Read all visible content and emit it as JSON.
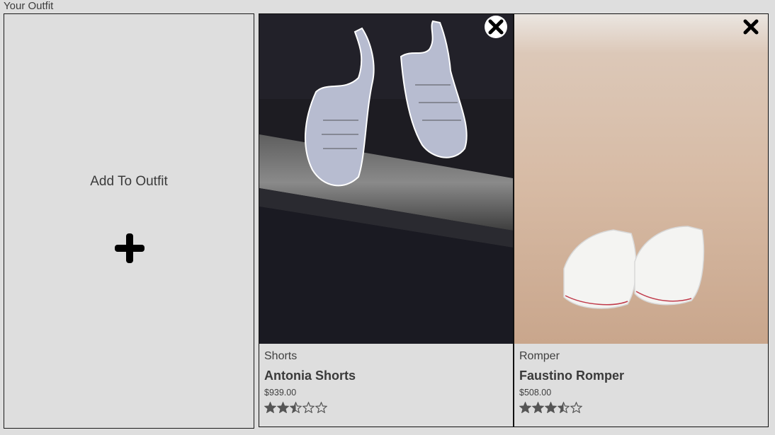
{
  "section": {
    "title": "Your Outfit"
  },
  "add_card": {
    "label": "Add To Outfit",
    "icon": "plus-icon"
  },
  "outfit": [
    {
      "category": "Shorts",
      "name": "Antonia Shorts",
      "price": "$939.00",
      "rating": 2.5,
      "image": "sneakers-on-ledge-photo",
      "remove_icon": "close-icon"
    },
    {
      "category": "Romper",
      "name": "Faustino Romper",
      "price": "$508.00",
      "rating": 3.5,
      "image": "white-sneakers-on-sand-photo",
      "remove_icon": "close-icon"
    }
  ]
}
